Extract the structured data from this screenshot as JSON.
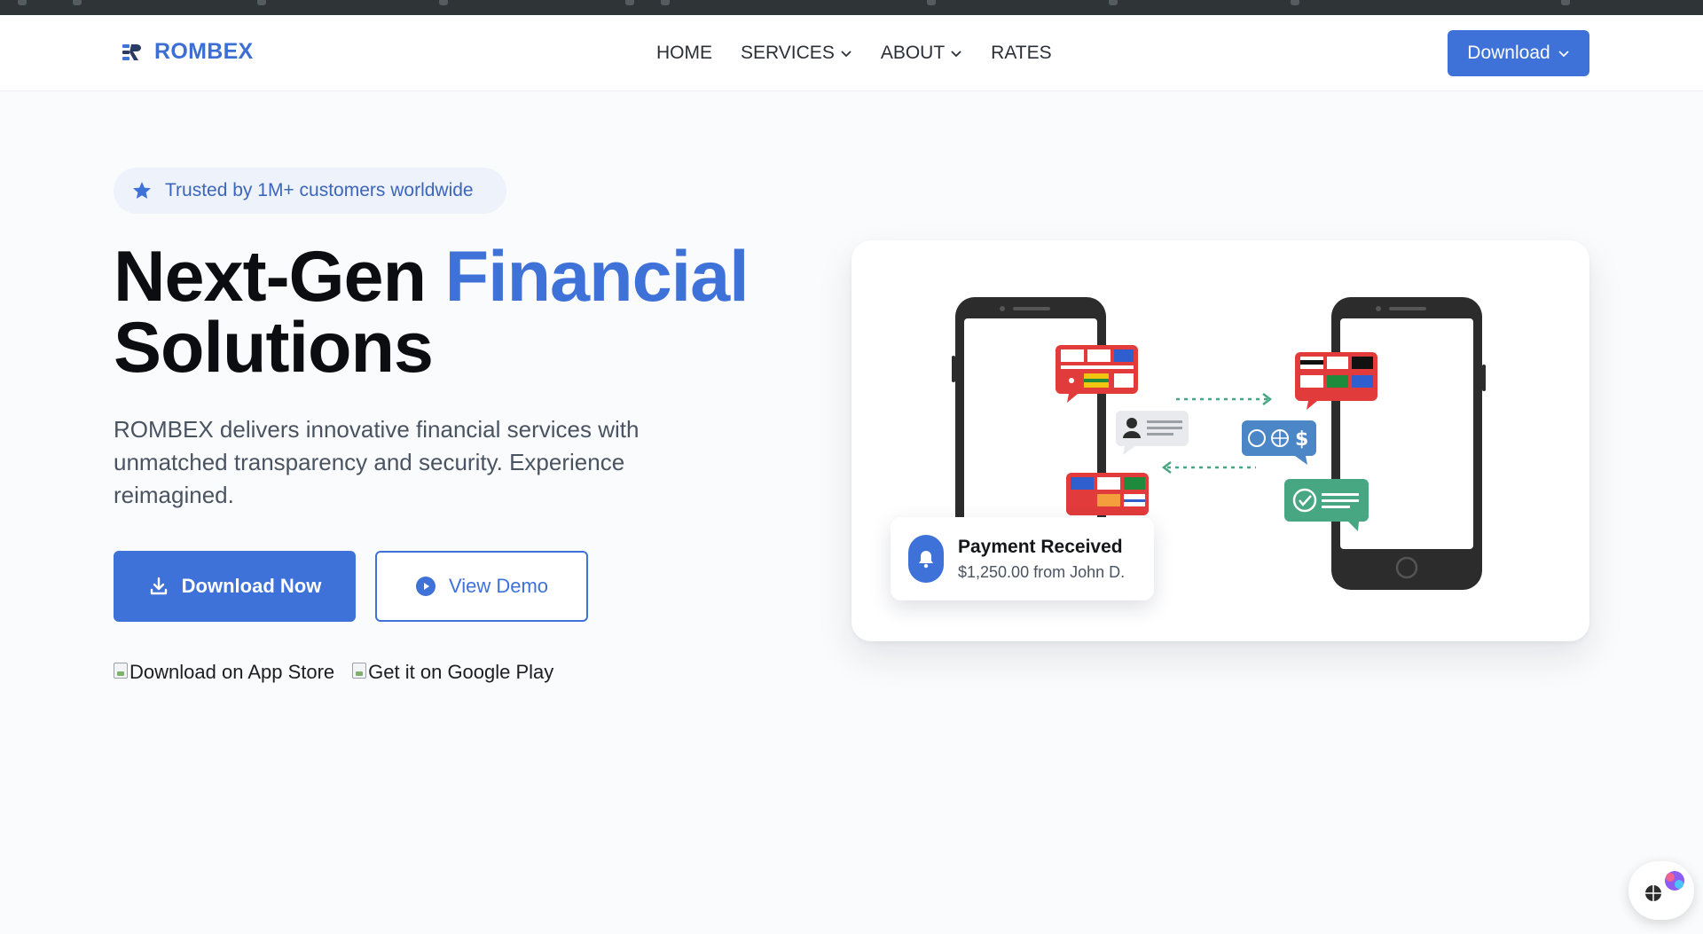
{
  "nav": {
    "brand": "ROMBEX",
    "links": [
      {
        "label": "HOME",
        "has_dropdown": false
      },
      {
        "label": "SERVICES",
        "has_dropdown": true
      },
      {
        "label": "ABOUT",
        "has_dropdown": true
      },
      {
        "label": "RATES",
        "has_dropdown": false
      }
    ],
    "download_label": "Download"
  },
  "hero": {
    "badge": "Trusted by 1M+ customers worldwide",
    "headline_part1": "Next-Gen",
    "headline_accent": "Financial",
    "headline_part2": "Solutions",
    "lead": "ROMBEX delivers innovative financial services with unmatched transparency and security. Experience reimagined.",
    "primary_cta": "Download Now",
    "secondary_cta": "View Demo",
    "store_links": [
      {
        "alt": "Download on App Store"
      },
      {
        "alt": "Get it on Google Play"
      }
    ]
  },
  "notification": {
    "title": "Payment Received",
    "detail": "$1,250.00 from John D."
  },
  "colors": {
    "brand_blue": "#3e72d8",
    "notif_green": "#47a782",
    "flag_red": "#e23b3b"
  },
  "icons": {
    "badge": "star-icon",
    "primary_cta": "download-icon",
    "secondary_cta": "play-circle-icon",
    "notification": "bell-icon"
  }
}
